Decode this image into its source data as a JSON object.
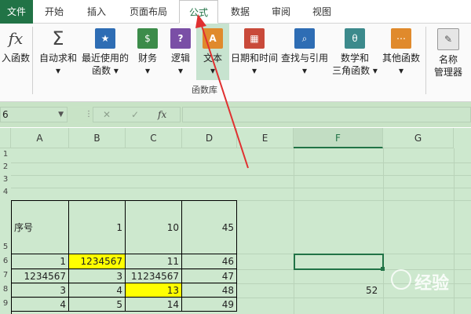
{
  "tabs": [
    "文件",
    "开始",
    "插入",
    "页面布局",
    "公式",
    "数据",
    "审阅",
    "视图"
  ],
  "active_tab": "公式",
  "ribbon": {
    "insert_function": "入函数",
    "autosum": "自动求和",
    "recent": [
      "最近使用的",
      "函数"
    ],
    "financial": "财务",
    "logical": "逻辑",
    "text": "文本",
    "datetime": "日期和时间",
    "lookup": "查找与引用",
    "math": [
      "数学和",
      "三角函数"
    ],
    "more": "其他函数",
    "name_mgr": [
      "名称",
      "管理器"
    ],
    "group_label": "函数库",
    "fx_glyph": "fx"
  },
  "formula_bar": {
    "name_box": "6",
    "fx": "fx",
    "content": ""
  },
  "columns": [
    "A",
    "B",
    "C",
    "D",
    "E",
    "F",
    "G"
  ],
  "selected_column": "F",
  "row_labels": [
    "1",
    "2",
    "3",
    "4",
    "5",
    "6",
    "7",
    "8",
    "9"
  ],
  "table": {
    "header": [
      "序号",
      "1",
      "10",
      "45"
    ],
    "rows": [
      [
        "1",
        "1234567",
        "11",
        "46"
      ],
      [
        "1234567",
        "3",
        "11234567",
        "47"
      ],
      [
        "3",
        "4",
        "13",
        "48"
      ],
      [
        "4",
        "5",
        "14",
        "49"
      ]
    ]
  },
  "extra_value": "52",
  "watermark": "经验",
  "colors": {
    "accent": "#217346",
    "highlight": "#ffff00",
    "arrow": "#e03030"
  }
}
